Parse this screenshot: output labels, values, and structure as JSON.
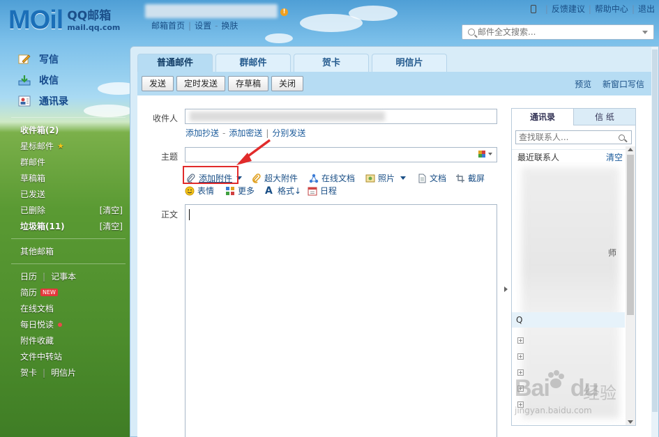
{
  "header": {
    "logo_mark": "MOil",
    "logo_title": "QQ邮箱",
    "logo_domain": "mail.qq.com",
    "links": [
      "邮箱首页",
      "设置",
      "换肤"
    ],
    "top_right": [
      "反馈建议",
      "帮助中心",
      "退出"
    ],
    "search_placeholder": "邮件全文搜索..."
  },
  "sidebar": {
    "main_items": [
      {
        "label": "写信",
        "icon": "write-icon"
      },
      {
        "label": "收信",
        "icon": "inbox-download-icon"
      },
      {
        "label": "通讯录",
        "icon": "contacts-icon"
      }
    ],
    "folders": [
      {
        "label": "收件箱(2)",
        "bold": true
      },
      {
        "label": "星标邮件",
        "badge": "★"
      },
      {
        "label": "群邮件"
      },
      {
        "label": "草稿箱"
      },
      {
        "label": "已发送"
      },
      {
        "label": "已删除",
        "right": "[清空]"
      },
      {
        "label": "垃圾箱(11)",
        "bold": true,
        "right": "[清空]"
      }
    ],
    "other": "其他邮箱",
    "apps": [
      {
        "label": "日历",
        "label2": "记事本"
      },
      {
        "label": "简历",
        "badge": "NEW"
      },
      {
        "label": "在线文档"
      },
      {
        "label": "每日悦读"
      },
      {
        "label": "附件收藏"
      },
      {
        "label": "文件中转站"
      },
      {
        "label": "贺卡",
        "label2": "明信片"
      }
    ]
  },
  "tabs": [
    "普通邮件",
    "群邮件",
    "贺卡",
    "明信片"
  ],
  "toolbar": {
    "buttons": [
      "发送",
      "定时发送",
      "存草稿",
      "关闭"
    ],
    "right_links": [
      "预览",
      "新窗口写信"
    ]
  },
  "compose": {
    "to_label": "收件人",
    "to_links": [
      "添加抄送",
      "添加密送",
      "分别发送"
    ],
    "subject_label": "主题",
    "body_label": "正文",
    "tools_row1": [
      {
        "label": "添加附件",
        "icon": "paperclip-icon"
      },
      {
        "label": "超大附件",
        "icon": "large-attachment-icon"
      },
      {
        "label": "在线文档",
        "icon": "share-doc-icon"
      },
      {
        "label": "照片",
        "icon": "photo-icon"
      },
      {
        "label": "文档",
        "icon": "document-icon"
      },
      {
        "label": "截屏",
        "icon": "screenshot-icon"
      }
    ],
    "tools_row2": [
      {
        "label": "表情",
        "icon": "emoji-icon"
      },
      {
        "label": "更多",
        "icon": "more-grid-icon"
      },
      {
        "label": "格式↓",
        "icon": "format-icon"
      },
      {
        "label": "日程",
        "icon": "calendar-icon"
      }
    ]
  },
  "right_panel": {
    "tabs": [
      "通讯录",
      "信 纸"
    ],
    "search_placeholder": "查找联系人...",
    "recent_label": "最近联系人",
    "clear_label": "清空",
    "partial_text": "师",
    "group_letter": "Q"
  },
  "watermark": {
    "brand": "Bai",
    "brand2": "du",
    "cn": "经验",
    "url": "jingyan.baidu.com"
  },
  "colors": {
    "accent": "#1b6fb8",
    "tab_active": "#b6dcf3",
    "highlight_box": "#e12b2b"
  }
}
